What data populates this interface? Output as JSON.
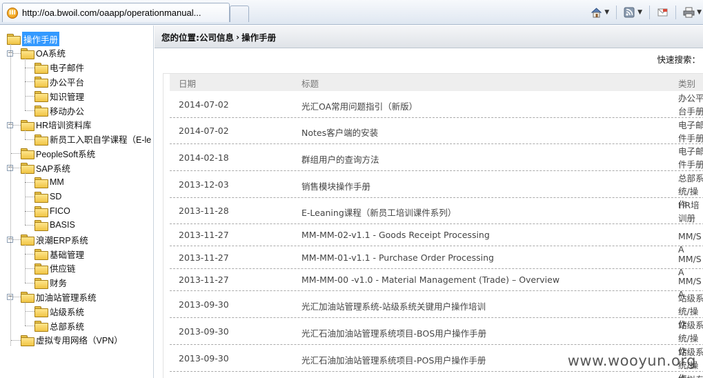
{
  "browser": {
    "tab_title": "http://oa.bwoil.com/oaapp/operationmanual...",
    "favicon": "oa-favicon-icon",
    "tools": [
      "home-icon",
      "feeds-icon",
      "mail-icon",
      "print-icon"
    ]
  },
  "tree": {
    "items": [
      {
        "label": "操作手册",
        "level": 0,
        "selected": true
      },
      {
        "label": "OA系统",
        "level": 1,
        "expander": "minus"
      },
      {
        "label": "电子邮件",
        "level": 2
      },
      {
        "label": "办公平台",
        "level": 2
      },
      {
        "label": "知识管理",
        "level": 2
      },
      {
        "label": "移动办公",
        "level": 2
      },
      {
        "label": "HR培训资料库",
        "level": 1,
        "expander": "minus"
      },
      {
        "label": "新员工入职自学课程（E-le",
        "level": 2
      },
      {
        "label": "PeopleSoft系统",
        "level": 1
      },
      {
        "label": "SAP系统",
        "level": 1,
        "expander": "minus"
      },
      {
        "label": "MM",
        "level": 2
      },
      {
        "label": "SD",
        "level": 2
      },
      {
        "label": "FICO",
        "level": 2
      },
      {
        "label": "BASIS",
        "level": 2
      },
      {
        "label": "浪潮ERP系统",
        "level": 1,
        "expander": "minus"
      },
      {
        "label": "基础管理",
        "level": 2
      },
      {
        "label": "供应链",
        "level": 2
      },
      {
        "label": "财务",
        "level": 2
      },
      {
        "label": "加油站管理系统",
        "level": 1,
        "expander": "minus"
      },
      {
        "label": "站级系统",
        "level": 2
      },
      {
        "label": "总部系统",
        "level": 2
      },
      {
        "label": "虚拟专用网络（VPN）",
        "level": 1
      }
    ]
  },
  "breadcrumb": {
    "prefix": "您的位置: ",
    "parent": "公司信息",
    "separator": "›",
    "current": "操作手册"
  },
  "quick_search_label": "快速搜索：",
  "table": {
    "headers": [
      "日期",
      "标题",
      "类别"
    ],
    "rows": [
      {
        "date": "2014-07-02",
        "title": "光汇OA常用问题指引（新版）",
        "category": "办公平台手册"
      },
      {
        "date": "2014-07-02",
        "title": "Notes客户端的安装",
        "category": "电子邮件手册"
      },
      {
        "date": "2014-02-18",
        "title": "群组用户的查询方法",
        "category": "电子邮件手册"
      },
      {
        "date": "2013-12-03",
        "title": "销售模块操作手册",
        "category": "总部系统/操作"
      },
      {
        "date": "2013-11-28",
        "title": "E-Leaning课程（新员工培训课件系列）",
        "category": "HR培训册"
      },
      {
        "date": "2013-11-27",
        "title": "MM-MM-02-v1.1 - Goods Receipt Processing",
        "category": "MM/SA"
      },
      {
        "date": "2013-11-27",
        "title": "MM-MM-01-v1.1 - Purchase Order Processing",
        "category": "MM/SA"
      },
      {
        "date": "2013-11-27",
        "title": "MM-MM-00 -v1.0 - Material Management (Trade) – Overview",
        "category": "MM/SA"
      },
      {
        "date": "2013-09-30",
        "title": "光汇加油站管理系统-站级系统关键用户操作培训",
        "category": "站级系统/操作"
      },
      {
        "date": "2013-09-30",
        "title": "光汇石油加油站管理系统项目-BOS用户操作手册",
        "category": "站级系统/操作"
      },
      {
        "date": "2013-09-30",
        "title": "光汇石油加油站管理系统项目-POS用户操作手册",
        "category": "站级系统/操作"
      },
      {
        "date": "",
        "title": "",
        "category": "虚拟专"
      }
    ]
  },
  "watermark": "www.wooyun.org"
}
